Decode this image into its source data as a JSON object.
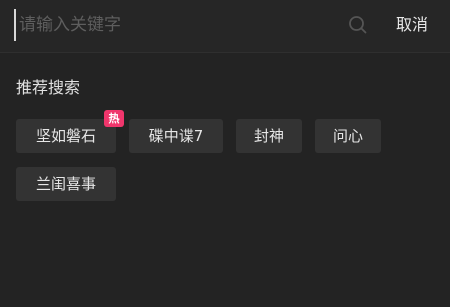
{
  "search": {
    "placeholder": "请输入关键字",
    "value": "",
    "cancel_label": "取消"
  },
  "recommend": {
    "title": "推荐搜索",
    "hot_badge": "热",
    "items": [
      {
        "label": "坚如磐石",
        "hot": true
      },
      {
        "label": "碟中谍7",
        "hot": false
      },
      {
        "label": "封神",
        "hot": false
      },
      {
        "label": "问心",
        "hot": false
      },
      {
        "label": "兰闺喜事",
        "hot": false
      }
    ]
  },
  "colors": {
    "background": "#232323",
    "chip_background": "#333333",
    "hot_badge": "#f0366c",
    "placeholder": "#5e5e5e"
  },
  "icons": {
    "search": "search-icon"
  }
}
